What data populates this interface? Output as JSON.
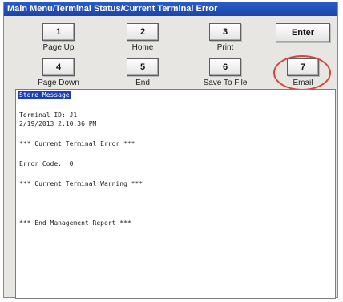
{
  "window": {
    "title": "Main Menu/Terminal Status/Current Terminal Error"
  },
  "buttons": [
    {
      "key": "1",
      "label": "Page Up"
    },
    {
      "key": "2",
      "label": "Home"
    },
    {
      "key": "3",
      "label": "Print"
    },
    {
      "key": "4",
      "label": "Page Down"
    },
    {
      "key": "5",
      "label": "End"
    },
    {
      "key": "6",
      "label": "Save To File"
    },
    {
      "key": "7",
      "label": "Email"
    }
  ],
  "enter_label": "Enter",
  "colors": {
    "title_bar": "#1f4fb8",
    "highlight_ring": "#d9443a",
    "report_header": "#1d3fb8"
  },
  "report": {
    "header": "Store Message",
    "lines": [
      "Terminal ID: J1",
      "2/19/2013 2:10:36 PM",
      "*** Current Terminal Error ***",
      "Error Code:  0",
      "*** Current Terminal Warning ***",
      "*** End Management Report ***"
    ]
  }
}
